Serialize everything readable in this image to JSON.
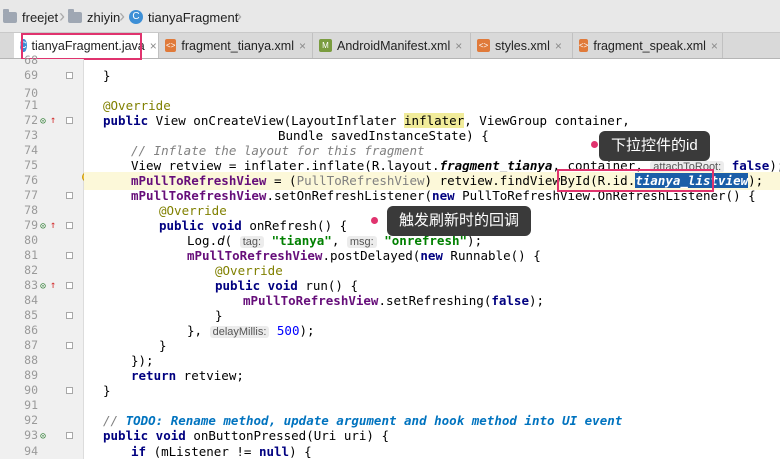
{
  "breadcrumb": {
    "items": [
      "freejet",
      "zhiyin",
      "tianyaFragment"
    ]
  },
  "tabs": [
    {
      "label": "tianyaFragment.java",
      "icon": "class-icon",
      "active": true
    },
    {
      "label": "fragment_tianya.xml",
      "icon": "xml-icon",
      "active": false
    },
    {
      "label": "AndroidManifest.xml",
      "icon": "manifest-icon",
      "active": false
    },
    {
      "label": "styles.xml",
      "icon": "xml-icon",
      "active": false
    },
    {
      "label": "fragment_speak.xml",
      "icon": "xml-icon",
      "active": false
    }
  ],
  "line_numbers": [
    "68",
    "69",
    "70",
    "71",
    "72",
    "73",
    "74",
    "75",
    "76",
    "77",
    "78",
    "79",
    "80",
    "81",
    "82",
    "83",
    "84",
    "85",
    "86",
    "87",
    "88",
    "89",
    "90",
    "91",
    "92",
    "93",
    "94"
  ],
  "code": {
    "l69": "}",
    "l71": "@Override",
    "l72_kw": "public",
    "l72_a": " View onCreateView(LayoutInflater ",
    "l72_var": "inflater",
    "l72_b": ", ViewGroup container,",
    "l73": "Bundle savedInstanceState) {",
    "l74": "// Inflate the layout for this fragment",
    "l75_a": "View retview = inflater.inflate(R.layout.",
    "l75_f": "fragment_tianya",
    "l75_b": ", container, ",
    "l75_hint": "attachToRoot:",
    "l75_kw": "false",
    "l75_c": ");",
    "l76_field": "mPullToRefreshView",
    "l76_a": " = (",
    "l76_cast": "PullToRefreshView",
    "l76_b": ") retview.findViewById(R.id.",
    "l76_sel": "tianya_listview",
    "l76_c": ");",
    "l77_field": "mPullToRefreshView",
    "l77_a": ".setOnRefreshListener(",
    "l77_kw": "new",
    "l77_b": " PullToRefreshView.OnRefreshListener() {",
    "l78": "@Override",
    "l79_kw": "public void",
    "l79_a": " onRefresh() {",
    "l80_a": "Log.",
    "l80_it": "d",
    "l80_h1": "tag:",
    "l80_s1": "\"tianya\"",
    "l80_b": ", ",
    "l80_h2": "msg:",
    "l80_s2": "\"onrefresh\"",
    "l80_c": ");",
    "l81_field": "mPullToRefreshView",
    "l81_a": ".postDelayed(",
    "l81_kw": "new",
    "l81_b": " Runnable() {",
    "l82": "@Override",
    "l83_kw": "public void",
    "l83_a": " run() {",
    "l84_field": "mPullToRefreshView",
    "l84_a": ".setRefreshing(",
    "l84_kw": "false",
    "l84_b": ");",
    "l85": "}",
    "l86_a": "}, ",
    "l86_hint": "delayMillis:",
    "l86_n": "500",
    "l86_b": ");",
    "l87": "}",
    "l88": "});",
    "l89_kw": "return",
    "l89_a": " retview;",
    "l90": "}",
    "l92_c": "// ",
    "l92_todo": "TODO: Rename method, update argument and hook method into UI event",
    "l93_kw": "public void",
    "l93_a": " onButtonPressed(Uri uri) {",
    "l94_kw": "if",
    "l94_a": " (mListener != ",
    "l94_kw2": "null",
    "l94_b": ") {"
  },
  "tooltips": {
    "pull_control_id": "下拉控件的id",
    "refresh_callback": "触发刷新时的回调"
  },
  "colors": {
    "highlight_box": "#e0336e",
    "tooltip_bg": "#3a3a3a",
    "keyword": "#000080",
    "field": "#660e7a",
    "string": "#008000",
    "selection": "#1a5ea8"
  }
}
